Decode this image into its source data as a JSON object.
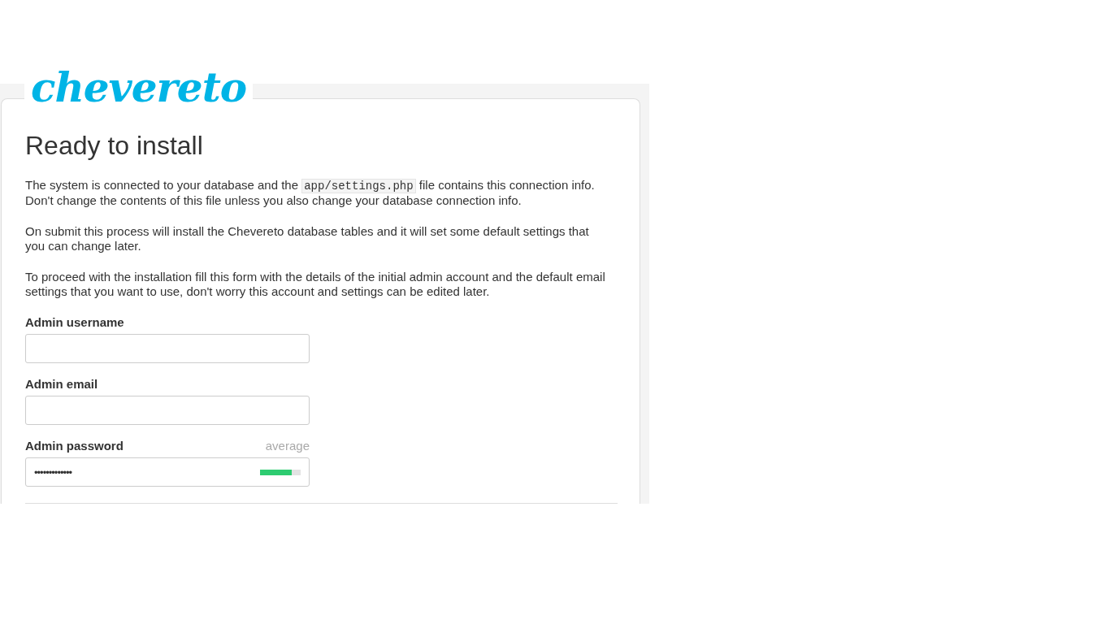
{
  "logo": {
    "text": "chevereto"
  },
  "title": "Ready to install",
  "paragraphs": [
    [
      {
        "kind": "text",
        "text": "The system is connected to your database and the "
      },
      {
        "kind": "code",
        "text": "app/settings.php"
      },
      {
        "kind": "text",
        "text": " file contains this connection info. Don't change the contents of this file unless you also change your database connection info."
      }
    ],
    [
      {
        "kind": "text",
        "text": "On submit this process will install the Chevereto database tables and it will set some default settings that you can change later."
      }
    ],
    [
      {
        "kind": "text",
        "text": "To proceed with the installation fill this form with the details of the initial admin account and the default email settings that you want to use, don't worry this account and settings can be edited later."
      }
    ]
  ],
  "fields": [
    {
      "label": "Admin username",
      "kind": "text"
    },
    {
      "label": "Admin email",
      "kind": "text"
    },
    {
      "label": "Admin password",
      "kind": "password",
      "value": "•••••••••••••",
      "strength": "average",
      "level": 0.77
    }
  ]
}
